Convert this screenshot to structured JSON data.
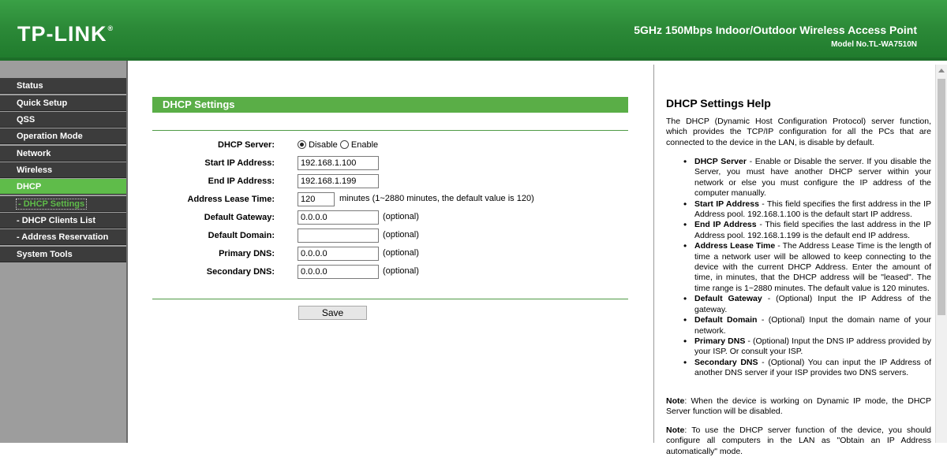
{
  "header": {
    "logo": "TP-LINK",
    "logo_mark": "®",
    "product_title": "5GHz 150Mbps Indoor/Outdoor Wireless Access Point",
    "model": "Model No.TL-WA7510N"
  },
  "sidebar": {
    "items": [
      {
        "label": "Status"
      },
      {
        "label": "Quick Setup"
      },
      {
        "label": "QSS"
      },
      {
        "label": "Operation Mode"
      },
      {
        "label": "Network"
      },
      {
        "label": "Wireless"
      },
      {
        "label": "DHCP"
      },
      {
        "label": "- DHCP Settings"
      },
      {
        "label": "- DHCP Clients List"
      },
      {
        "label": "- Address Reservation"
      },
      {
        "label": "System Tools"
      }
    ]
  },
  "form": {
    "title": "DHCP Settings",
    "dhcp_server_label": "DHCP Server:",
    "disable_label": "Disable",
    "enable_label": "Enable",
    "dhcp_server_selected": "Disable",
    "start_ip_label": "Start IP Address:",
    "start_ip_value": "192.168.1.100",
    "end_ip_label": "End IP Address:",
    "end_ip_value": "192.168.1.199",
    "lease_label": "Address Lease Time:",
    "lease_value": "120",
    "lease_note": "minutes (1~2880 minutes, the default value is 120)",
    "gateway_label": "Default Gateway:",
    "gateway_value": "0.0.0.0",
    "domain_label": "Default Domain:",
    "domain_value": "",
    "primary_dns_label": "Primary DNS:",
    "primary_dns_value": "0.0.0.0",
    "secondary_dns_label": "Secondary DNS:",
    "secondary_dns_value": "0.0.0.0",
    "optional": "(optional)",
    "save_label": "Save"
  },
  "help": {
    "title": "DHCP Settings Help",
    "intro": "The DHCP (Dynamic Host Configuration Protocol) server function, which provides the TCP/IP configuration for all the PCs that are connected to the device in the LAN, is disable by default.",
    "items": [
      {
        "term": "DHCP Server",
        "text": " - Enable or Disable the server. If you disable the Server, you must have another DHCP server within your network or else you must configure the IP address of the computer manually."
      },
      {
        "term": "Start IP Address",
        "text": " - This field specifies the first address in the IP Address pool. 192.168.1.100 is the default start IP address."
      },
      {
        "term": "End IP Address",
        "text": " - This field specifies the last address in the IP Address pool. 192.168.1.199 is the default end IP address."
      },
      {
        "term": "Address Lease Time",
        "text": " - The Address Lease Time is the length of time a network user will be allowed to keep connecting to the device with the current DHCP Address. Enter the amount of time, in minutes, that the DHCP address will be \"leased\". The time range is 1~2880 minutes. The default value is 120 minutes."
      },
      {
        "term": "Default Gateway",
        "text": " - (Optional) Input the IP Address of the gateway."
      },
      {
        "term": "Default Domain",
        "text": " - (Optional) Input the domain name of your network."
      },
      {
        "term": "Primary DNS",
        "text": " - (Optional) Input the DNS IP address provided by your ISP. Or consult your ISP."
      },
      {
        "term": "Secondary DNS",
        "text": " - (Optional) You can input the IP Address of another DNS server if your ISP provides two DNS servers."
      }
    ],
    "note1_term": "Note",
    "note1": ": When the device is working on Dynamic IP mode, the DHCP Server function will be disabled.",
    "note2_term": "Note",
    "note2": ": To use the DHCP server function of the device, you should configure all computers in the LAN as \"Obtain an IP Address automatically\" mode."
  }
}
